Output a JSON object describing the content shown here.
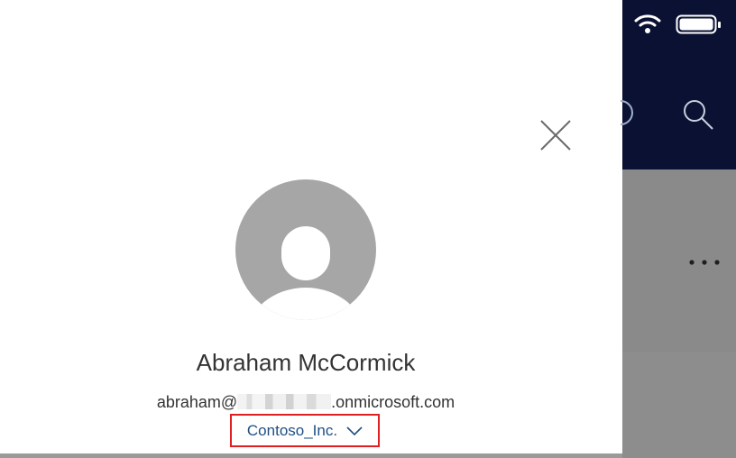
{
  "profile": {
    "name": "Abraham McCormick",
    "email_prefix": "abraham@",
    "email_suffix": ".onmicrosoft.com",
    "tenant": "Contoso_Inc."
  },
  "icons": {
    "close": "close-icon",
    "avatar": "default-avatar-icon",
    "tenant_dropdown": "chevron-down-icon",
    "wifi": "wifi-icon",
    "battery": "battery-icon",
    "refresh": "refresh-icon",
    "search": "search-icon",
    "more": "more-icon"
  },
  "colors": {
    "panel_bg": "#ffffff",
    "avatar": "#a6a6a6",
    "tenant_link": "#1e4f86",
    "highlight_box": "#e02020",
    "app_header": "#0b1133",
    "app_body": "#8a8a8a"
  }
}
